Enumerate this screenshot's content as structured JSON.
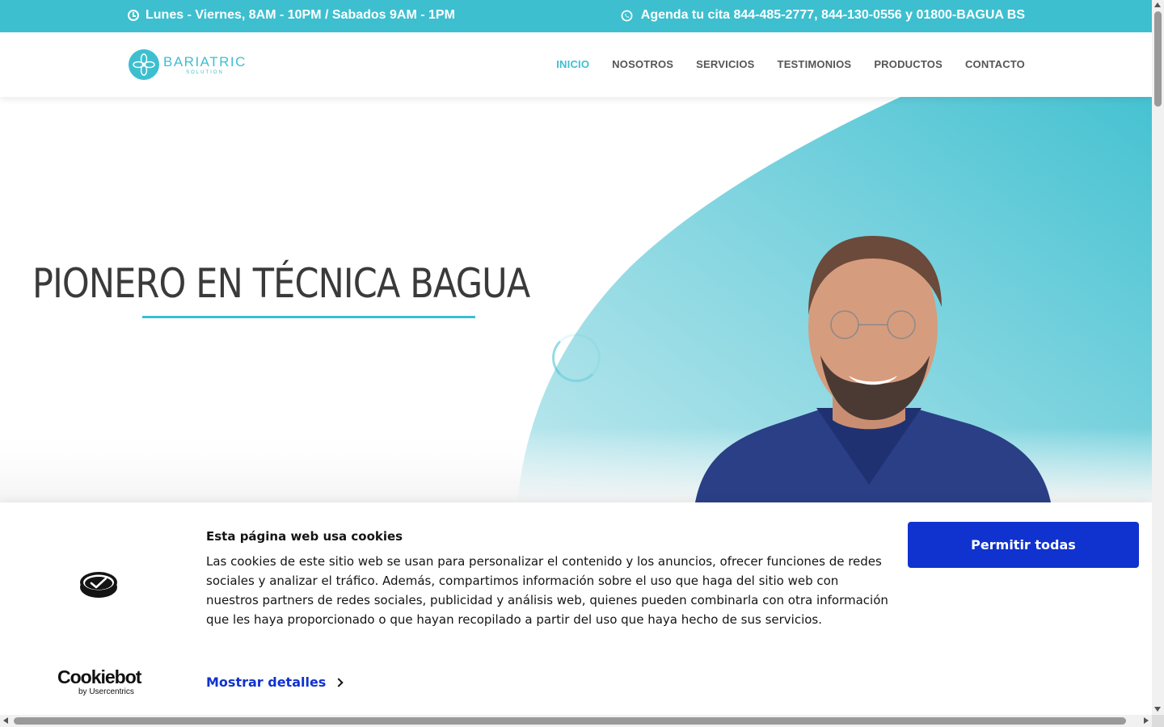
{
  "topbar": {
    "hours": "Lunes - Viernes, 8AM - 10PM / Sabados 9AM - 1PM",
    "hours_icon": "clock-icon",
    "appointment": "Agenda tu cita 844-485-2777, 844-130-0556 y 01800-BAGUA BS",
    "appointment_icon": "whatsapp-icon",
    "bg_color": "#3dbfcf"
  },
  "header": {
    "logo_main": "BARIATRIC",
    "logo_sub": "SOLUTION",
    "nav": [
      {
        "label": "INICIO",
        "active": true
      },
      {
        "label": "NOSOTROS",
        "active": false
      },
      {
        "label": "SERVICIOS",
        "active": false
      },
      {
        "label": "TESTIMONIOS",
        "active": false
      },
      {
        "label": "PRODUCTOS",
        "active": false
      },
      {
        "label": "CONTACTO",
        "active": false
      }
    ]
  },
  "hero": {
    "title": "PIONERO EN TÉCNICA BAGUA",
    "accent_color": "#3dbfcf"
  },
  "cookie": {
    "title": "Esta página web usa cookies",
    "text": "Las cookies de este sitio web se usan para personalizar el contenido y los anuncios, ofrecer funciones de redes sociales y analizar el tráfico. Además, compartimos información sobre el uso que haga del sitio web con nuestros partners de redes sociales, publicidad y análisis web, quienes pueden combinarla con otra información que les haya proporcionado o que hayan recopilado a partir del uso que haya hecho de sus servicios.",
    "details_link": "Mostrar detalles",
    "allow_button": "Permitir todas",
    "brand": "Cookiebot",
    "brand_sub": "by Usercentrics",
    "button_color": "#1032cf"
  }
}
